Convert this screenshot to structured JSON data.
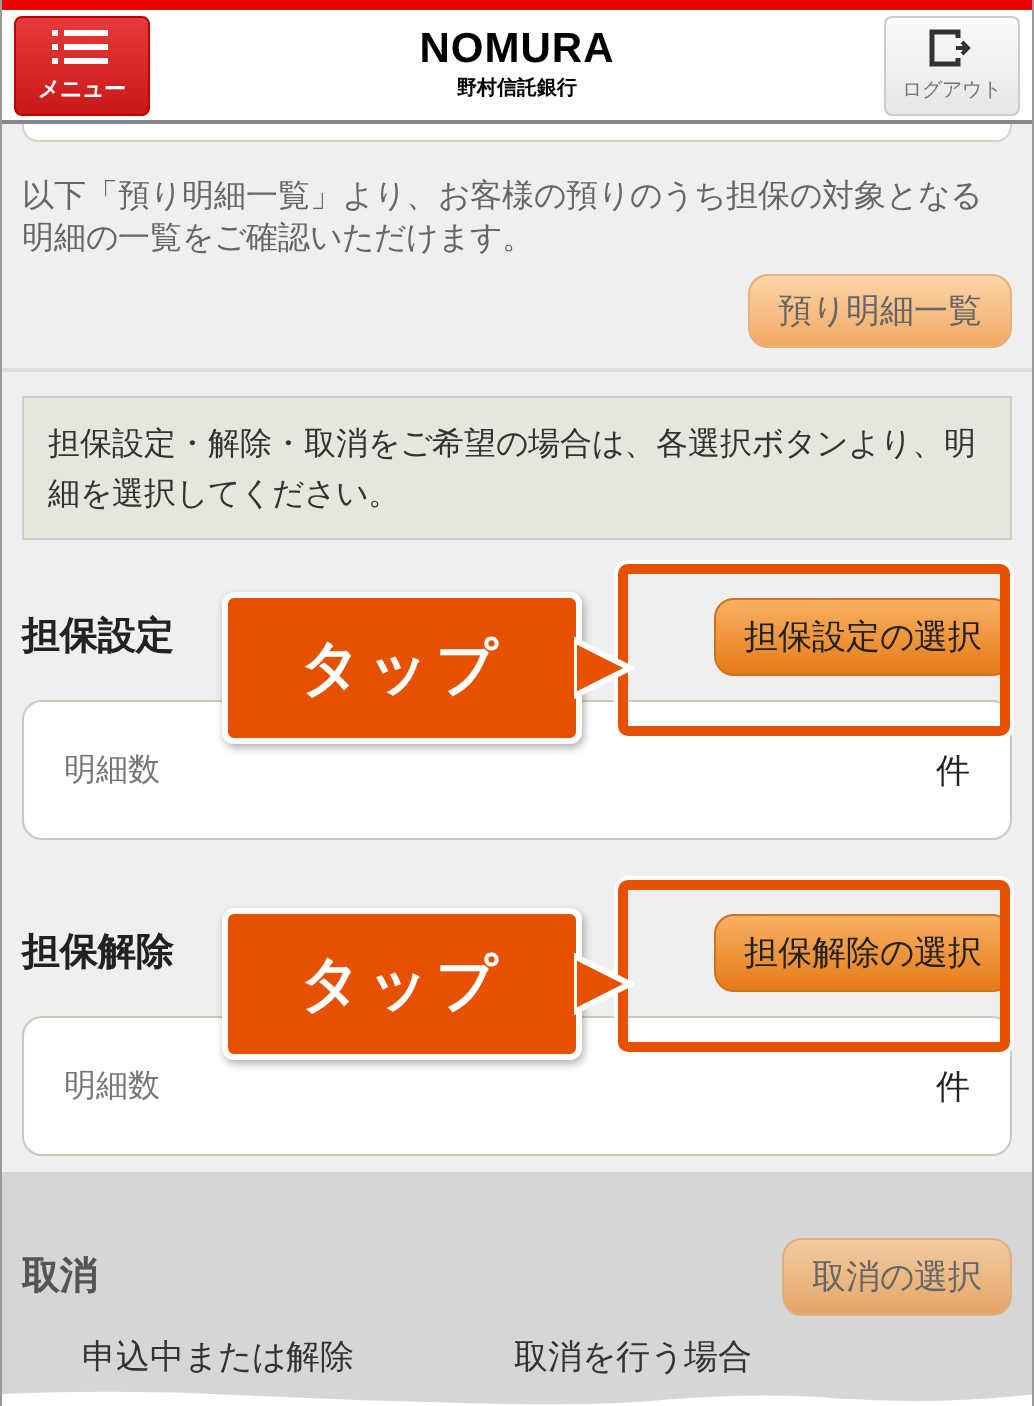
{
  "header": {
    "menu_label": "メニュー",
    "logo": "NOMURA",
    "logo_sub": "野村信託銀行",
    "logout_label": "ログアウト"
  },
  "intro": {
    "text": "以下「預り明細一覧」より、お客様の預りのうち担保の対象となる明細の一覧をご確認いただけます。",
    "button": "預り明細一覧"
  },
  "notice": "担保設定・解除・取消をご希望の場合は、各選択ボタンより、明細を選択してください。",
  "sections": [
    {
      "kind": "field",
      "title": "担保設定",
      "button": "担保設定の選択",
      "field_label": "明細数",
      "unit": "件",
      "callout": "タップ",
      "dimmed": false
    },
    {
      "kind": "field",
      "title": "担保解除",
      "button": "担保解除の選択",
      "field_label": "明細数",
      "unit": "件",
      "callout": "タップ",
      "dimmed": false
    },
    {
      "kind": "plain",
      "title": "取消",
      "button": "取消の選択",
      "dimmed": true
    }
  ],
  "footer_fragments": [
    "申込中または解除",
    "取消を行う場合"
  ]
}
